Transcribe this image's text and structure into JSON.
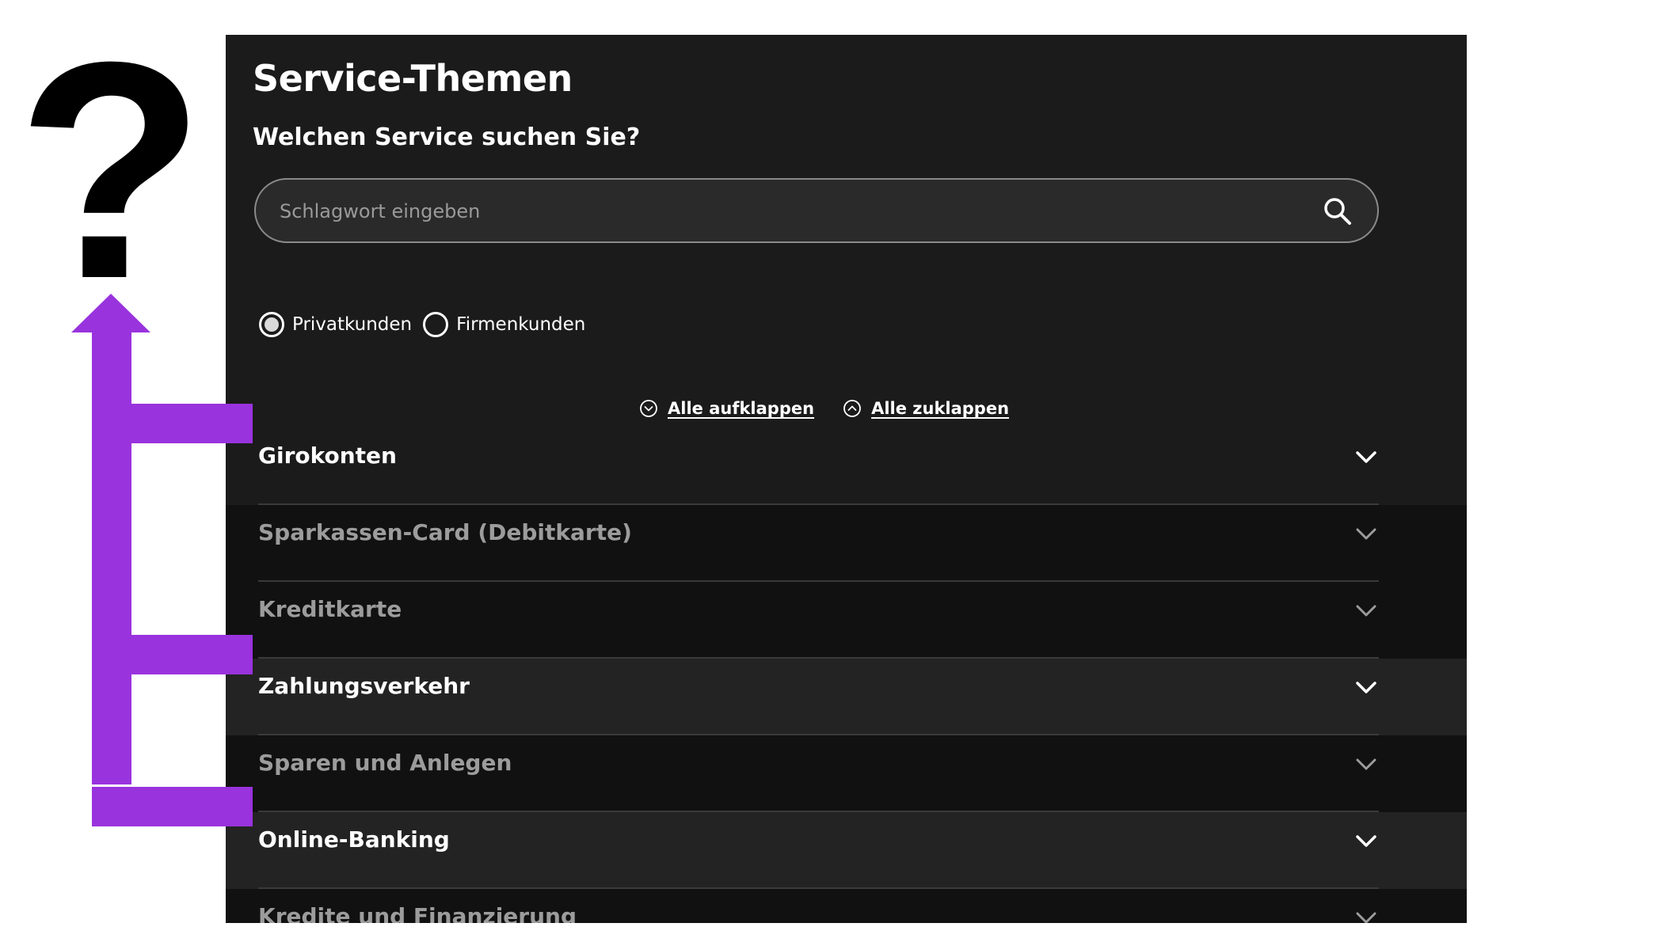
{
  "panel": {
    "title": "Service-Themen",
    "subtitle": "Welchen Service suchen Sie?"
  },
  "search": {
    "placeholder": "Schlagwort eingeben",
    "icon": "search-icon"
  },
  "customer_type": {
    "options": [
      {
        "label": "Privatkunden",
        "selected": true
      },
      {
        "label": "Firmenkunden",
        "selected": false
      }
    ]
  },
  "controls": {
    "expand_all": "Alle aufklappen",
    "collapse_all": "Alle zuklappen"
  },
  "accordion": {
    "items": [
      {
        "label": "Girokonten",
        "state": "highlighted"
      },
      {
        "label": "Sparkassen-Card (Debitkarte)",
        "state": "dimmed"
      },
      {
        "label": "Kreditkarte",
        "state": "dimmed"
      },
      {
        "label": "Zahlungsverkehr",
        "state": "highlighted"
      },
      {
        "label": "Sparen und Anlegen",
        "state": "dimmed"
      },
      {
        "label": "Online-Banking",
        "state": "highlighted"
      },
      {
        "label": "Kredite und Finanzierung",
        "state": "dimmed"
      }
    ]
  },
  "overlay": {
    "question_mark": "?",
    "arrow_color": "#9933dd",
    "question_color": "#000000"
  },
  "colors": {
    "panel_bg": "#1b1b1b",
    "dim_row_bg": "#111111",
    "highlight_row_bg": "#232323",
    "dim_text": "#9c9c9c",
    "text": "#ffffff"
  }
}
